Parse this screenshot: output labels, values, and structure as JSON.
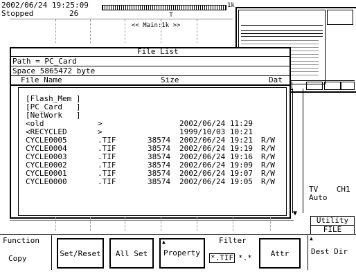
{
  "status": {
    "datetime": "2002/06/24 19:25:09",
    "state": "Stopped",
    "count": "26",
    "memory_label": "1k",
    "main_label": "<< Main:1k >>"
  },
  "file_list": {
    "title": "File List",
    "path": "Path = PC_Card",
    "space": "Space 5865472 byte",
    "col_name": "File Name",
    "col_size": "Size",
    "col_date": "Dat",
    "devices": [
      "[Flash_Mem ]",
      "[PC_Card   ]",
      "[NetWork   ]"
    ],
    "rows": [
      {
        "name": "<old",
        "ext": ">",
        "size": "",
        "date": "2002/06/24 11:29",
        "attr": ""
      },
      {
        "name": "<RECYCLED",
        "ext": ">",
        "size": "",
        "date": "1999/10/03 10:21",
        "attr": ""
      },
      {
        "name": "CYCLE0005",
        "ext": ".TIF",
        "size": "38574",
        "date": "2002/06/24 19:21",
        "attr": "R/W"
      },
      {
        "name": "CYCLE0004",
        "ext": ".TIF",
        "size": "38574",
        "date": "2002/06/24 19:19",
        "attr": "R/W"
      },
      {
        "name": "CYCLE0003",
        "ext": ".TIF",
        "size": "38574",
        "date": "2002/06/24 19:16",
        "attr": "R/W"
      },
      {
        "name": "CYCLE0002",
        "ext": ".TIF",
        "size": "38574",
        "date": "2002/06/24 19:09",
        "attr": "R/W"
      },
      {
        "name": "CYCLE0001",
        "ext": ".TIF",
        "size": "38574",
        "date": "2002/06/24 19:07",
        "attr": "R/W"
      },
      {
        "name": "CYCLE0000",
        "ext": ".TIF",
        "size": "38574",
        "date": "2002/06/24 19:05",
        "attr": "R/W"
      }
    ]
  },
  "right_info": {
    "channel": "TV    CH1",
    "mode": "Auto"
  },
  "softkeys": {
    "utility_label": "Utility",
    "file_tab": "FILE",
    "function_label": "Function",
    "function_value": "Copy",
    "set_reset": "Set/Reset",
    "all_set": "All Set",
    "property": "Property",
    "filter_label": "Filter",
    "filter_opt1": "*.TIF",
    "filter_opt2": "*.*",
    "attr": "Attr",
    "dest_dir": "Dest Dir"
  },
  "arrow_up": "▲",
  "arrow_down": "▼"
}
